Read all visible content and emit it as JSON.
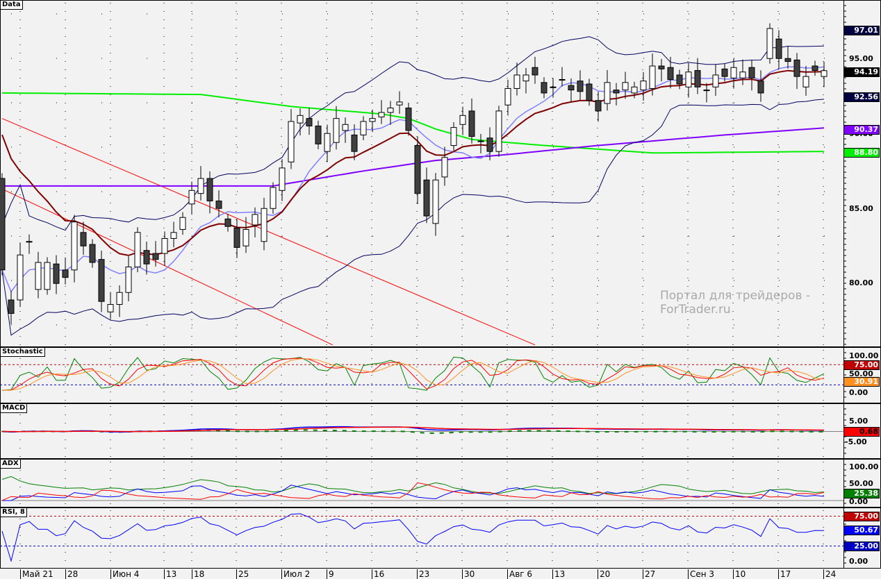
{
  "panels": {
    "main": "Data",
    "stoch": "Stochastic",
    "macd": "MACD",
    "adx": "ADX",
    "rsi": "RSI, 8"
  },
  "watermark": "Портал для трейдеров - ForTrader.ru",
  "x_ticks": [
    "Май 21",
    "28",
    "Июн 4",
    "13",
    "18",
    "25",
    "Июл 2",
    "9",
    "16",
    "23",
    "30",
    "Авг 6",
    "13",
    "20",
    "27",
    "Сен 3",
    "10",
    "17",
    "24"
  ],
  "chart_data": [
    {
      "type": "candlestick",
      "title": "Data",
      "ylim": [
        75.8,
        98.9
      ],
      "y_ticks": [
        "95.00",
        "90.00",
        "85.00",
        "80.00"
      ],
      "open": [
        87.0,
        78.9,
        78.9,
        82.8,
        79.6,
        79.6,
        81.3,
        80.9,
        80.9,
        83.4,
        82.6,
        81.6,
        78.1,
        78.6,
        79.4,
        81.1,
        82.2,
        82.0,
        82.0,
        83.0,
        83.6,
        85.3,
        86.0,
        87.0,
        85.5,
        84.3,
        83.7,
        82.5,
        83.9,
        82.8,
        85.0,
        86.2,
        88.1,
        90.7,
        91.0,
        90.5,
        88.8,
        89.4,
        90.2,
        89.9,
        89.9,
        90.8,
        91.1,
        91.4,
        91.9,
        91.7,
        89.2,
        86.9,
        84.0,
        87.1,
        89.2,
        90.6,
        91.5,
        89.5,
        89.7,
        88.8,
        91.9,
        93.0,
        93.5,
        94.4,
        93.4,
        93.1,
        93.6,
        93.2,
        93.5,
        93.3,
        92.2,
        92.0,
        92.9,
        92.9,
        92.7,
        92.9,
        93.0,
        94.5,
        94.4,
        93.9,
        93.1,
        94.2,
        92.9,
        93.1,
        94.3,
        93.7,
        93.7,
        94.4,
        93.5,
        95.0,
        96.3,
        95.0,
        94.9,
        93.1,
        94.5,
        93.8
      ],
      "close": [
        80.9,
        78.0,
        81.9,
        82.8,
        81.4,
        81.4,
        80.0,
        80.4,
        84.1,
        82.5,
        81.4,
        78.8,
        78.6,
        79.4,
        81.1,
        83.4,
        81.3,
        81.6,
        83.0,
        83.4,
        84.4,
        86.2,
        87.0,
        85.5,
        85.0,
        83.8,
        82.4,
        83.6,
        84.6,
        85.0,
        86.4,
        87.7,
        90.8,
        91.2,
        90.5,
        89.3,
        90.0,
        91.0,
        90.6,
        88.8,
        90.8,
        91.0,
        91.4,
        91.7,
        92.1,
        90.2,
        86.0,
        84.5,
        86.9,
        88.4,
        90.4,
        91.2,
        89.8,
        89.5,
        88.8,
        91.5,
        93.0,
        93.9,
        93.9,
        93.9,
        92.7,
        93.1,
        93.6,
        92.9,
        92.8,
        92.2,
        91.5,
        93.4,
        92.7,
        93.4,
        93.1,
        93.5,
        94.5,
        94.3,
        93.6,
        93.3,
        94.1,
        93.1,
        92.9,
        93.9,
        93.8,
        94.4,
        94.1,
        93.7,
        92.7,
        97.0,
        95.0,
        94.8,
        93.8,
        93.8,
        94.2,
        94.19
      ],
      "ma_long_green": [
        [
          0,
          92.7
        ],
        [
          22,
          92.6
        ],
        [
          32,
          91.8
        ],
        [
          42,
          91.3
        ],
        [
          45,
          91.0
        ],
        [
          48,
          90.3
        ],
        [
          52,
          89.6
        ],
        [
          60,
          89.2
        ],
        [
          72,
          88.7
        ],
        [
          91,
          88.8
        ]
      ],
      "ma_long_purple": [
        [
          0,
          86.5
        ],
        [
          30,
          86.5
        ],
        [
          40,
          87.5
        ],
        [
          48,
          88.2
        ],
        [
          56,
          88.6
        ],
        [
          66,
          89.2
        ],
        [
          80,
          89.9
        ],
        [
          91,
          90.37
        ]
      ],
      "trendlines": [
        [
          [
            0,
            91.0
          ],
          [
            59,
            75.9
          ]
        ],
        [
          [
            0,
            86.3
          ],
          [
            36.6,
            75.9
          ]
        ]
      ],
      "last_values": {
        "bb_upper": "97.01",
        "close": "94.19",
        "bb_lower": "92.56",
        "purple": "90.37",
        "green": "88.80"
      }
    },
    {
      "type": "line",
      "title": "Stochastic",
      "ylim": [
        0,
        100
      ],
      "y_ticks": [
        "100.00",
        "50.00",
        "0.00"
      ],
      "levels": {
        "upper": "75.00",
        "lower": "20.00"
      },
      "last": "30.91"
    },
    {
      "type": "line",
      "title": "MACD",
      "ylim": [
        -8,
        8
      ],
      "y_ticks": [
        "5.00",
        "-5.00"
      ],
      "last": "0.68"
    },
    {
      "type": "line",
      "title": "ADX",
      "ylim": [
        0,
        100
      ],
      "y_ticks": [
        "100.00",
        "50.00",
        "0.00"
      ],
      "last": "25.38"
    },
    {
      "type": "line",
      "title": "RSI, 8",
      "ylim": [
        0,
        100
      ],
      "y_ticks": [
        "0.00"
      ],
      "levels": {
        "upper": "75.00",
        "lower": "25.00"
      },
      "last": "50.67"
    }
  ],
  "colors": {
    "up": "#ffffff",
    "down": "#404040",
    "bb": "#000060",
    "fast": "#8080ff",
    "slow": "#800000",
    "green": "#00ee00",
    "purple": "#8000ff",
    "trend": "#ff0000"
  }
}
